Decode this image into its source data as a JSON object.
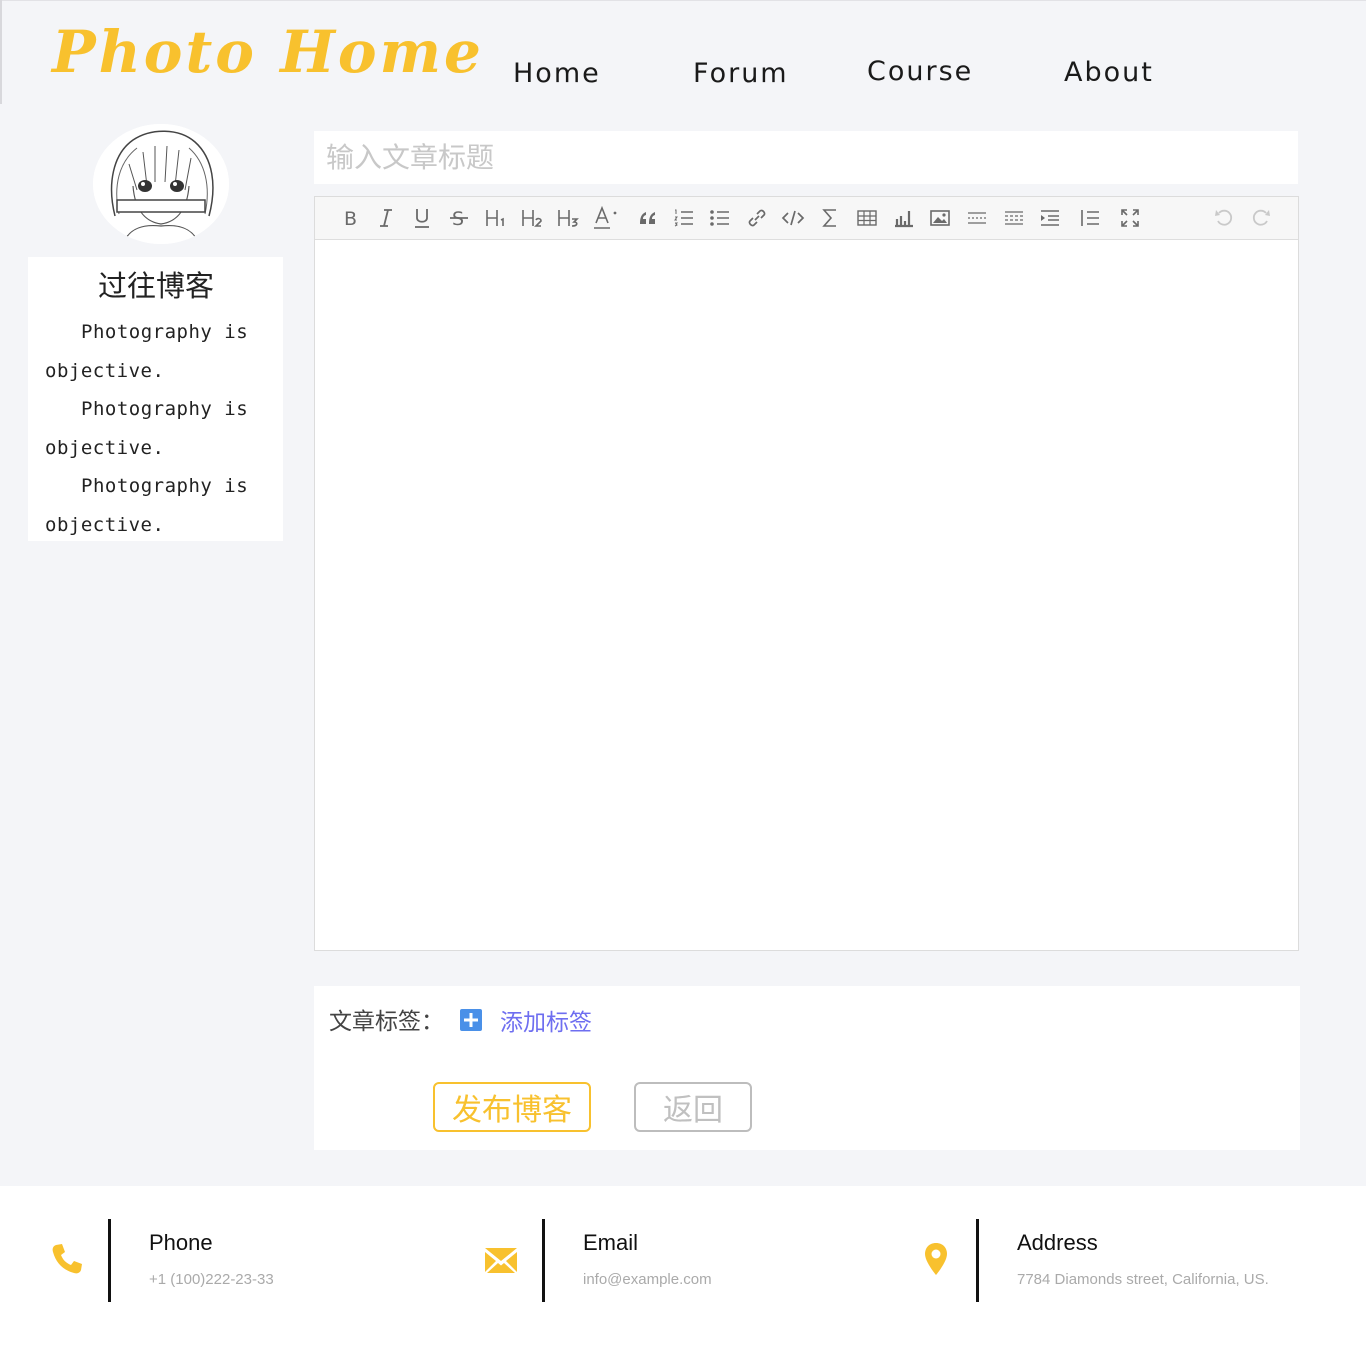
{
  "header": {
    "logo": "Photo Home",
    "nav": [
      "Home",
      "Forum",
      "Course",
      "About"
    ]
  },
  "sidebar": {
    "past_title": "过往博客",
    "past_items": [
      "Photography is objective.",
      "Photography is objective.",
      "Photography is objective."
    ]
  },
  "editor": {
    "title_placeholder": "输入文章标题",
    "toolbar_icons": [
      "bold-icon",
      "italic-icon",
      "underline-icon",
      "strikethrough-icon",
      "heading-1-icon",
      "heading-2-icon",
      "heading-3-icon",
      "font-color-icon",
      "quote-icon",
      "ordered-list-icon",
      "unordered-list-icon",
      "link-icon",
      "code-icon",
      "formula-icon",
      "table-icon",
      "chart-icon",
      "image-icon",
      "divider-icon",
      "page-break-icon",
      "indent-icon",
      "line-numbers-icon",
      "fullscreen-icon",
      "undo-icon",
      "redo-icon"
    ]
  },
  "tags": {
    "label": "文章标签：",
    "add_label": "添加标签"
  },
  "actions": {
    "publish": "发布博客",
    "back": "返回"
  },
  "footer": {
    "phone_label": "Phone",
    "phone_value": "+1 (100)222-23-33",
    "email_label": "Email",
    "email_value": "info@example.com",
    "address_label": "Address",
    "address_value": "7784 Diamonds street, California, US."
  },
  "colors": {
    "accent": "#f8c12e",
    "link": "#6e6ef0",
    "background": "#f4f5f8"
  }
}
